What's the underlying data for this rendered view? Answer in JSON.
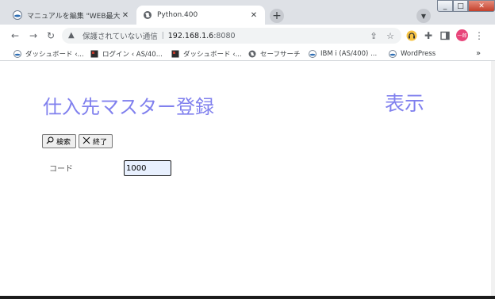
{
  "browser": {
    "tabs": [
      {
        "title": "マニュアルを編集 \"WEB最大表",
        "icon": "wordpress-favicon-icon",
        "active": false
      },
      {
        "title": "Python.400",
        "icon": "globe-favicon-icon",
        "active": true
      }
    ],
    "new_tab": "+",
    "close_glyph": "✕",
    "window_controls": {
      "minimize": "_",
      "maximize": "□",
      "close": "✕"
    },
    "address": {
      "security_text": "保護されていない通信",
      "separator": "|",
      "host": "192.168.1.6",
      "port": ":8080"
    },
    "bookmarks": [
      {
        "label": "ダッシュボード ‹...",
        "icon": "wordpress-icon"
      },
      {
        "label": "ログイン ‹ AS/40...",
        "icon": "dark-square-icon"
      },
      {
        "label": "ダッシュボード ‹...",
        "icon": "dark-square-icon"
      },
      {
        "label": "セーフサーチ",
        "icon": "globe-icon"
      },
      {
        "label": "IBM i (AS/400) ...",
        "icon": "wordpress-icon"
      },
      {
        "label": "WordPress",
        "icon": "wordpress-icon"
      }
    ],
    "bookmarks_more": "»",
    "profile_text": "一郎"
  },
  "page": {
    "title": "仕入先マスター登録",
    "mode": "表示",
    "buttons": {
      "search": "検索",
      "exit": "終了"
    },
    "fields": {
      "code_label": "コード",
      "code_value": "1000"
    }
  },
  "colors": {
    "heading": "#8080ee",
    "tabstrip": "#dee1e6",
    "profile": "#e8457a"
  }
}
